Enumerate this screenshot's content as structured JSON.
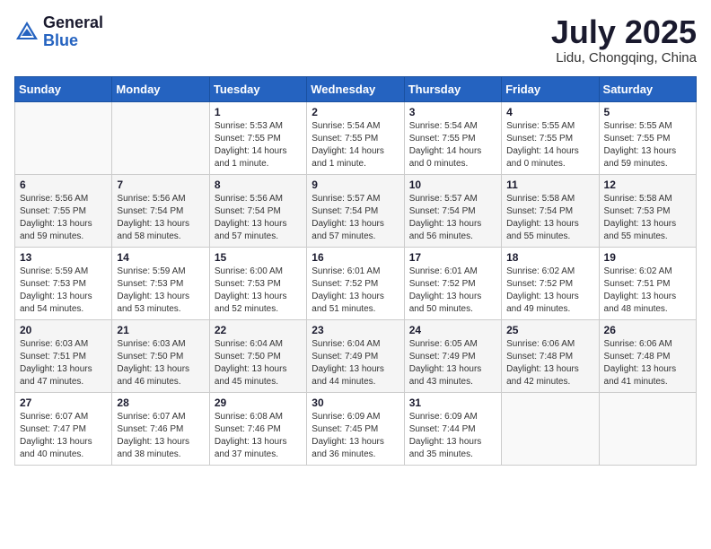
{
  "logo": {
    "general": "General",
    "blue": "Blue"
  },
  "title": {
    "month": "July 2025",
    "location": "Lidu, Chongqing, China"
  },
  "weekdays": [
    "Sunday",
    "Monday",
    "Tuesday",
    "Wednesday",
    "Thursday",
    "Friday",
    "Saturday"
  ],
  "weeks": [
    [
      {
        "day": "",
        "info": ""
      },
      {
        "day": "",
        "info": ""
      },
      {
        "day": "1",
        "info": "Sunrise: 5:53 AM\nSunset: 7:55 PM\nDaylight: 14 hours and 1 minute."
      },
      {
        "day": "2",
        "info": "Sunrise: 5:54 AM\nSunset: 7:55 PM\nDaylight: 14 hours and 1 minute."
      },
      {
        "day": "3",
        "info": "Sunrise: 5:54 AM\nSunset: 7:55 PM\nDaylight: 14 hours and 0 minutes."
      },
      {
        "day": "4",
        "info": "Sunrise: 5:55 AM\nSunset: 7:55 PM\nDaylight: 14 hours and 0 minutes."
      },
      {
        "day": "5",
        "info": "Sunrise: 5:55 AM\nSunset: 7:55 PM\nDaylight: 13 hours and 59 minutes."
      }
    ],
    [
      {
        "day": "6",
        "info": "Sunrise: 5:56 AM\nSunset: 7:55 PM\nDaylight: 13 hours and 59 minutes."
      },
      {
        "day": "7",
        "info": "Sunrise: 5:56 AM\nSunset: 7:54 PM\nDaylight: 13 hours and 58 minutes."
      },
      {
        "day": "8",
        "info": "Sunrise: 5:56 AM\nSunset: 7:54 PM\nDaylight: 13 hours and 57 minutes."
      },
      {
        "day": "9",
        "info": "Sunrise: 5:57 AM\nSunset: 7:54 PM\nDaylight: 13 hours and 57 minutes."
      },
      {
        "day": "10",
        "info": "Sunrise: 5:57 AM\nSunset: 7:54 PM\nDaylight: 13 hours and 56 minutes."
      },
      {
        "day": "11",
        "info": "Sunrise: 5:58 AM\nSunset: 7:54 PM\nDaylight: 13 hours and 55 minutes."
      },
      {
        "day": "12",
        "info": "Sunrise: 5:58 AM\nSunset: 7:53 PM\nDaylight: 13 hours and 55 minutes."
      }
    ],
    [
      {
        "day": "13",
        "info": "Sunrise: 5:59 AM\nSunset: 7:53 PM\nDaylight: 13 hours and 54 minutes."
      },
      {
        "day": "14",
        "info": "Sunrise: 5:59 AM\nSunset: 7:53 PM\nDaylight: 13 hours and 53 minutes."
      },
      {
        "day": "15",
        "info": "Sunrise: 6:00 AM\nSunset: 7:53 PM\nDaylight: 13 hours and 52 minutes."
      },
      {
        "day": "16",
        "info": "Sunrise: 6:01 AM\nSunset: 7:52 PM\nDaylight: 13 hours and 51 minutes."
      },
      {
        "day": "17",
        "info": "Sunrise: 6:01 AM\nSunset: 7:52 PM\nDaylight: 13 hours and 50 minutes."
      },
      {
        "day": "18",
        "info": "Sunrise: 6:02 AM\nSunset: 7:52 PM\nDaylight: 13 hours and 49 minutes."
      },
      {
        "day": "19",
        "info": "Sunrise: 6:02 AM\nSunset: 7:51 PM\nDaylight: 13 hours and 48 minutes."
      }
    ],
    [
      {
        "day": "20",
        "info": "Sunrise: 6:03 AM\nSunset: 7:51 PM\nDaylight: 13 hours and 47 minutes."
      },
      {
        "day": "21",
        "info": "Sunrise: 6:03 AM\nSunset: 7:50 PM\nDaylight: 13 hours and 46 minutes."
      },
      {
        "day": "22",
        "info": "Sunrise: 6:04 AM\nSunset: 7:50 PM\nDaylight: 13 hours and 45 minutes."
      },
      {
        "day": "23",
        "info": "Sunrise: 6:04 AM\nSunset: 7:49 PM\nDaylight: 13 hours and 44 minutes."
      },
      {
        "day": "24",
        "info": "Sunrise: 6:05 AM\nSunset: 7:49 PM\nDaylight: 13 hours and 43 minutes."
      },
      {
        "day": "25",
        "info": "Sunrise: 6:06 AM\nSunset: 7:48 PM\nDaylight: 13 hours and 42 minutes."
      },
      {
        "day": "26",
        "info": "Sunrise: 6:06 AM\nSunset: 7:48 PM\nDaylight: 13 hours and 41 minutes."
      }
    ],
    [
      {
        "day": "27",
        "info": "Sunrise: 6:07 AM\nSunset: 7:47 PM\nDaylight: 13 hours and 40 minutes."
      },
      {
        "day": "28",
        "info": "Sunrise: 6:07 AM\nSunset: 7:46 PM\nDaylight: 13 hours and 38 minutes."
      },
      {
        "day": "29",
        "info": "Sunrise: 6:08 AM\nSunset: 7:46 PM\nDaylight: 13 hours and 37 minutes."
      },
      {
        "day": "30",
        "info": "Sunrise: 6:09 AM\nSunset: 7:45 PM\nDaylight: 13 hours and 36 minutes."
      },
      {
        "day": "31",
        "info": "Sunrise: 6:09 AM\nSunset: 7:44 PM\nDaylight: 13 hours and 35 minutes."
      },
      {
        "day": "",
        "info": ""
      },
      {
        "day": "",
        "info": ""
      }
    ]
  ]
}
